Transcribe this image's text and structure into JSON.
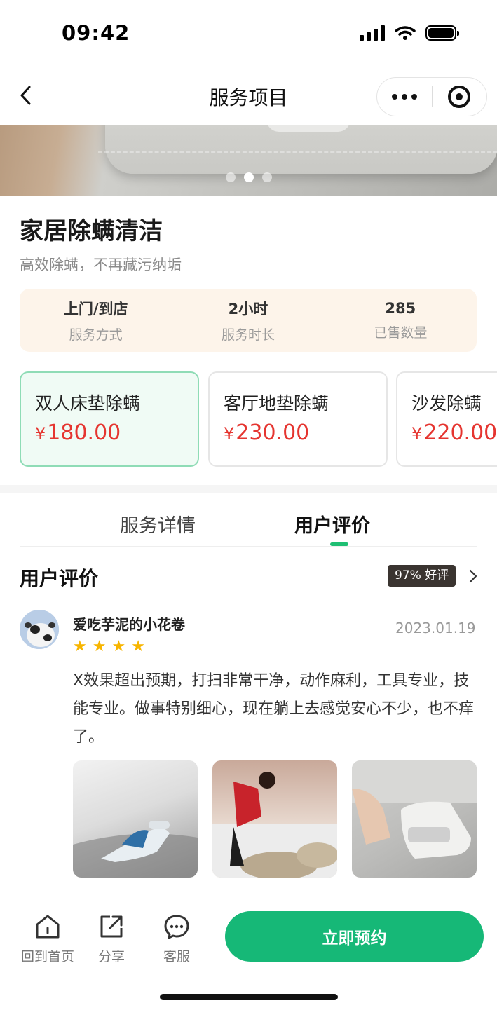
{
  "status_bar": {
    "time": "09:42"
  },
  "nav": {
    "title": "服务项目",
    "back_icon": "chevron-left-icon",
    "more_icon": "more-dots-icon",
    "close_icon": "target-icon"
  },
  "banner": {
    "page_count": 3,
    "active_index": 1
  },
  "product": {
    "title": "家居除螨清洁",
    "subtitle": "高效除螨，不再藏污纳垢",
    "info": [
      {
        "value": "上门/到店",
        "label": "服务方式"
      },
      {
        "value": "2小时",
        "label": "服务时长"
      },
      {
        "value": "285",
        "label": "已售数量"
      }
    ]
  },
  "options": [
    {
      "name": "双人床垫除螨",
      "currency": "¥",
      "price": "180.00",
      "selected": true
    },
    {
      "name": "客厅地垫除螨",
      "currency": "¥",
      "price": "230.00",
      "selected": false
    },
    {
      "name": "沙发除螨",
      "currency": "¥",
      "price": "220.00",
      "selected": false
    }
  ],
  "tabs": [
    {
      "label": "服务详情",
      "active": false
    },
    {
      "label": "用户评价",
      "active": true
    }
  ],
  "reviews": {
    "heading": "用户评价",
    "rating_badge": "97% 好评",
    "items": [
      {
        "user": "爱吃芋泥的小花卷",
        "date": "2023.01.19",
        "stars": 4,
        "text": "X效果超出预期，打扫非常干净，动作麻利，工具专业，技能专业。做事特别细心，现在躺上去感觉安心不少，也不痒了。",
        "photos": [
          "mite-vacuum-on-bed-photo",
          "worker-cleaning-mattress-photo",
          "hand-holding-mite-vacuum-photo"
        ]
      }
    ]
  },
  "bottom_bar": {
    "items": [
      {
        "label": "回到首页",
        "icon": "home-icon"
      },
      {
        "label": "分享",
        "icon": "share-icon"
      },
      {
        "label": "客服",
        "icon": "customer-service-icon"
      }
    ],
    "book_button": "立即预约"
  },
  "colors": {
    "accent_green": "#16b877",
    "price_red": "#e53530",
    "star_yellow": "#f7b500",
    "info_bg": "#fdf4ea",
    "selected_card_bg": "#f0fbf5"
  }
}
